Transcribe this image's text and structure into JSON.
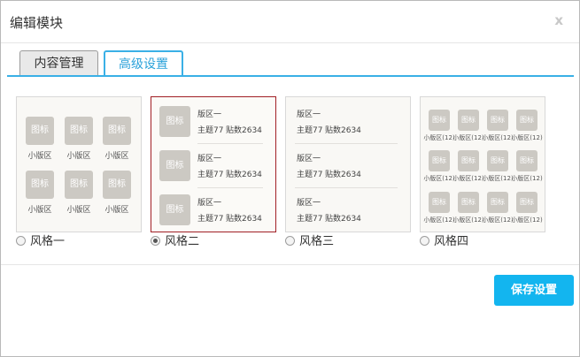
{
  "dialog": {
    "title": "编辑模块",
    "close": "x"
  },
  "tabs": [
    {
      "label": "内容管理"
    },
    {
      "label": "高级设置"
    }
  ],
  "styles": {
    "icon_text": "图标",
    "small_area": "小版区",
    "small_area_count": "小版区(12)",
    "area": "版区一",
    "topics": "主题77",
    "posts": "贴数2634"
  },
  "options": [
    {
      "label": "风格一",
      "selected": false
    },
    {
      "label": "风格二",
      "selected": true
    },
    {
      "label": "风格三",
      "selected": false
    },
    {
      "label": "风格四",
      "selected": false
    }
  ],
  "footer": {
    "save_label": "保存设置"
  },
  "colors": {
    "accent": "#3ab0e6",
    "save_button": "#13b5ef",
    "selected_border": "#a11f25"
  }
}
